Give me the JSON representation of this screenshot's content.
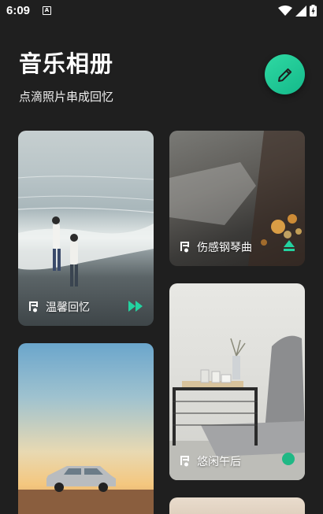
{
  "status": {
    "time": "6:09",
    "notification_icon": "A"
  },
  "header": {
    "title": "音乐相册",
    "subtitle": "点滴照片串成回忆"
  },
  "colors": {
    "accent": "#20c997",
    "background": "#1f1f1f"
  },
  "albums": [
    {
      "label": "温馨回忆",
      "icon": "music-note-icon",
      "action_icon": "fast-forward-icon"
    },
    {
      "label": "伤感钢琴曲",
      "icon": "music-note-icon",
      "action_icon": "eject-icon"
    },
    {
      "label": "悠闲午后",
      "icon": "music-note-icon",
      "action_icon": "green-dot-icon"
    }
  ]
}
